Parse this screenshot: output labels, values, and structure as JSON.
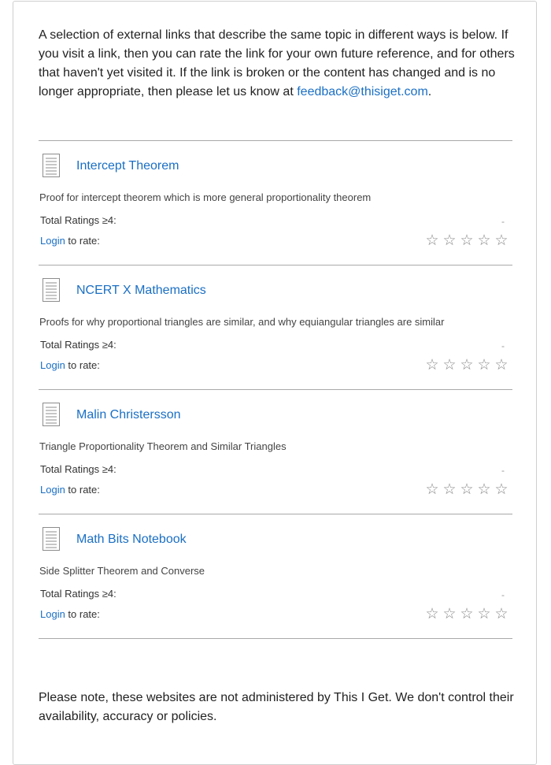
{
  "intro": {
    "text": "A selection of external links that describe the same topic in different ways is below. If you visit a link, then you can rate the link for your own future reference, and for others that haven't yet visited it. If the link is broken or the content has changed and is no longer appropriate, then please let us know at ",
    "email": "feedback@thisiget.com",
    "end": "."
  },
  "links": [
    {
      "title": "Intercept Theorem",
      "description": "Proof for intercept theorem which is more general proportionality theorem",
      "ratings_label": "Total Ratings ≥4:",
      "ratings_value": "-",
      "login_label": "Login",
      "rate_suffix": " to rate:",
      "stars": [
        "☆",
        "☆",
        "☆",
        "☆",
        "☆"
      ]
    },
    {
      "title": "NCERT X Mathematics",
      "description": "Proofs for why proportional triangles are similar, and why equiangular triangles are similar",
      "ratings_label": "Total Ratings ≥4:",
      "ratings_value": "-",
      "login_label": "Login",
      "rate_suffix": " to rate:",
      "stars": [
        "☆",
        "☆",
        "☆",
        "☆",
        "☆"
      ]
    },
    {
      "title": "Malin Christersson",
      "description": "Triangle Proportionality Theorem and Similar Triangles",
      "ratings_label": "Total Ratings ≥4:",
      "ratings_value": "-",
      "login_label": "Login",
      "rate_suffix": " to rate:",
      "stars": [
        "☆",
        "☆",
        "☆",
        "☆",
        "☆"
      ]
    },
    {
      "title": "Math Bits Notebook",
      "description": "Side Splitter Theorem and Converse",
      "ratings_label": "Total Ratings ≥4:",
      "ratings_value": "-",
      "login_label": "Login",
      "rate_suffix": " to rate:",
      "stars": [
        "☆",
        "☆",
        "☆",
        "☆",
        "☆"
      ]
    }
  ],
  "note": {
    "text": "Please note, these websites are not administered by This I Get. We don't control their availability, accuracy or policies."
  },
  "icons": {
    "document": "document-icon",
    "star": "star-outline-icon"
  },
  "colors": {
    "link": "#1a6fc4",
    "divider": "#a9a9a9",
    "star": "#8a8a8a"
  }
}
